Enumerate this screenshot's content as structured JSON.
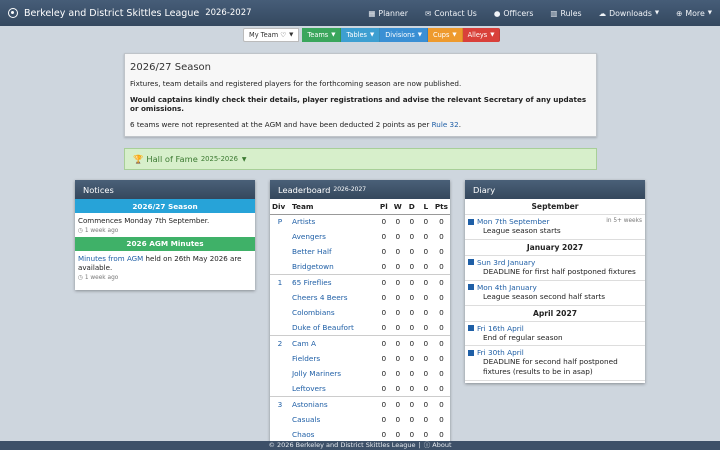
{
  "navbar": {
    "title": "Berkeley and District Skittles League",
    "season": "2026-2027",
    "links": [
      {
        "icon": "calendar-icon",
        "glyph": "▦",
        "label": "Planner",
        "caret": false
      },
      {
        "icon": "envelope-icon",
        "glyph": "✉",
        "label": "Contact Us",
        "caret": false
      },
      {
        "icon": "user-icon",
        "glyph": "●",
        "label": "Officers",
        "caret": false
      },
      {
        "icon": "book-icon",
        "glyph": "▥",
        "label": "Rules",
        "caret": false
      },
      {
        "icon": "cloud-download-icon",
        "glyph": "☁",
        "label": "Downloads",
        "caret": true
      },
      {
        "icon": "plus-circle-icon",
        "glyph": "⊕",
        "label": "More",
        "caret": true
      }
    ]
  },
  "pills": {
    "my_team": "My Team ♡",
    "teams": "Teams",
    "tables": "Tables",
    "divisions": "Divisions",
    "cups": "Cups",
    "alleys": "Alleys"
  },
  "season_box": {
    "title": "2026/27 Season",
    "p1": "Fixtures, team details and registered players for the forthcoming season are now published.",
    "p2": "Would captains kindly check their details, player registrations and advise the relevant Secretary of any updates or omissions.",
    "p3_pre": "6 teams were not represented at the AGM and have been deducted 2 points as per ",
    "p3_link": "Rule 32",
    "p3_post": "."
  },
  "hall_of_fame": {
    "label": "Hall of Fame",
    "season": "2025-2026"
  },
  "notices": {
    "title": "Notices",
    "items": [
      {
        "heading": "2026/27 Season",
        "body_pre": "Commences Monday 7th September.",
        "link": "",
        "body_post": "",
        "meta": "1 week ago"
      },
      {
        "heading": "2026 AGM Minutes",
        "body_pre": "",
        "link": "Minutes from AGM",
        "body_post": " held on 26th May 2026 are available.",
        "meta": "1 week ago"
      }
    ]
  },
  "leaderboard": {
    "title": "Leaderboard",
    "season": "2026-2027",
    "headers": [
      "Div",
      "Team",
      "Pl",
      "W",
      "D",
      "L",
      "Pts"
    ],
    "rows": [
      {
        "div": "P",
        "team": "Artists",
        "pl": "0",
        "w": "0",
        "d": "0",
        "l": "0",
        "pts": "0"
      },
      {
        "div": "",
        "team": "Avengers",
        "pl": "0",
        "w": "0",
        "d": "0",
        "l": "0",
        "pts": "0"
      },
      {
        "div": "",
        "team": "Better Half",
        "pl": "0",
        "w": "0",
        "d": "0",
        "l": "0",
        "pts": "0"
      },
      {
        "div": "",
        "team": "Bridgetown",
        "pl": "0",
        "w": "0",
        "d": "0",
        "l": "0",
        "pts": "0"
      },
      {
        "div": "1",
        "team": "65 Fireflies",
        "pl": "0",
        "w": "0",
        "d": "0",
        "l": "0",
        "pts": "0"
      },
      {
        "div": "",
        "team": "Cheers 4 Beers",
        "pl": "0",
        "w": "0",
        "d": "0",
        "l": "0",
        "pts": "0"
      },
      {
        "div": "",
        "team": "Colombians",
        "pl": "0",
        "w": "0",
        "d": "0",
        "l": "0",
        "pts": "0"
      },
      {
        "div": "",
        "team": "Duke of Beaufort",
        "pl": "0",
        "w": "0",
        "d": "0",
        "l": "0",
        "pts": "0"
      },
      {
        "div": "2",
        "team": "Cam A",
        "pl": "0",
        "w": "0",
        "d": "0",
        "l": "0",
        "pts": "0"
      },
      {
        "div": "",
        "team": "Fielders",
        "pl": "0",
        "w": "0",
        "d": "0",
        "l": "0",
        "pts": "0"
      },
      {
        "div": "",
        "team": "Jolly Mariners",
        "pl": "0",
        "w": "0",
        "d": "0",
        "l": "0",
        "pts": "0"
      },
      {
        "div": "",
        "team": "Leftovers",
        "pl": "0",
        "w": "0",
        "d": "0",
        "l": "0",
        "pts": "0"
      },
      {
        "div": "3",
        "team": "Astonians",
        "pl": "0",
        "w": "0",
        "d": "0",
        "l": "0",
        "pts": "0"
      },
      {
        "div": "",
        "team": "Casuals",
        "pl": "0",
        "w": "0",
        "d": "0",
        "l": "0",
        "pts": "0"
      },
      {
        "div": "",
        "team": "Chaos",
        "pl": "0",
        "w": "0",
        "d": "0",
        "l": "0",
        "pts": "0"
      }
    ]
  },
  "diary": {
    "title": "Diary",
    "sections": [
      {
        "month": "September",
        "entries": [
          {
            "date": "Mon 7th September",
            "desc": "League season starts",
            "note": "in 5+ weeks"
          }
        ]
      },
      {
        "month": "January 2027",
        "entries": [
          {
            "date": "Sun 3rd January",
            "desc": "DEADLINE for first half postponed fixtures",
            "note": ""
          },
          {
            "date": "Mon 4th January",
            "desc": "League season second half starts",
            "note": ""
          }
        ]
      },
      {
        "month": "April 2027",
        "entries": [
          {
            "date": "Fri 16th April",
            "desc": "End of regular season",
            "note": ""
          },
          {
            "date": "Fri 30th April",
            "desc": "DEADLINE for second half postponed fixtures (results to be in asap)",
            "note": ""
          }
        ]
      }
    ]
  },
  "footer": {
    "text": "© 2026 Berkeley and District Skittles League",
    "about": "About"
  }
}
